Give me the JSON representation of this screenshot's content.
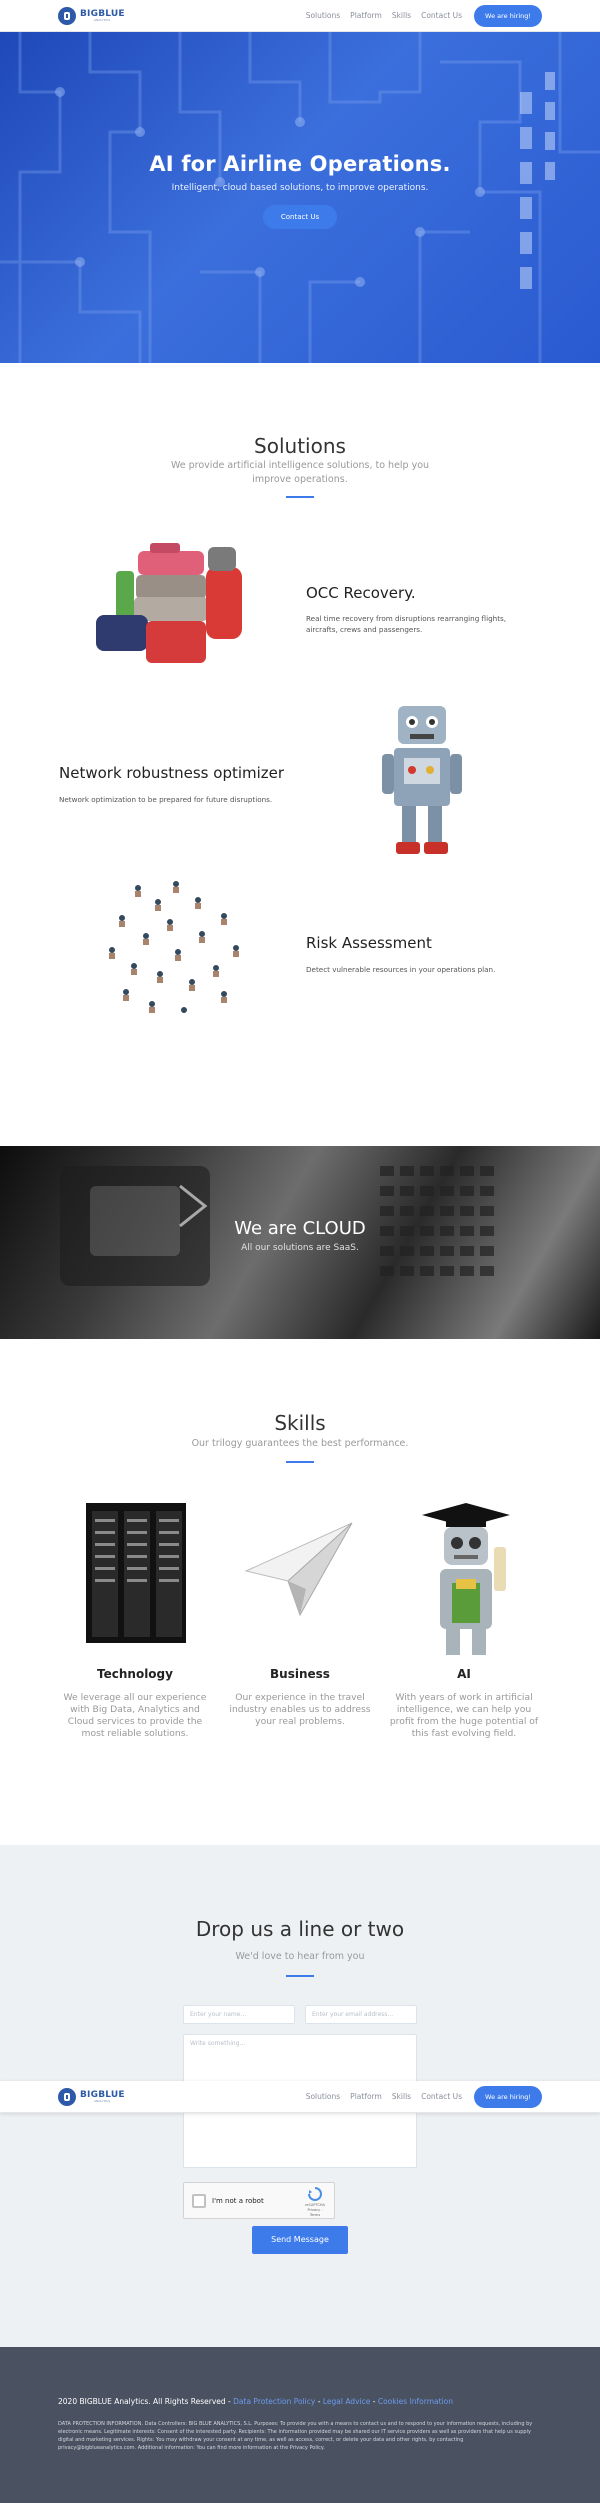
{
  "brand": {
    "name": "BIGBLUE",
    "tagline": "ANALYTICS"
  },
  "nav": {
    "links": [
      "Solutions",
      "Platform",
      "Skills",
      "Contact Us"
    ],
    "cta": "We are hiring!"
  },
  "hero": {
    "title": "AI for Airline Operations.",
    "subtitle": "Intelligent, cloud based solutions, to improve operations.",
    "button": "Contact Us"
  },
  "solutions": {
    "title": "Solutions",
    "subtitle": "We provide artificial intelligence solutions, to help you improve operations.",
    "items": [
      {
        "title": "OCC Recovery.",
        "text": "Real time recovery from disruptions rearranging flights, aircrafts, crews and passengers.",
        "image": "luggage-icon"
      },
      {
        "title": "Network robustness optimizer",
        "text": "Network optimization to be prepared for future disruptions.",
        "image": "robot-icon"
      },
      {
        "title": "Risk Assessment",
        "text": "Detect vulnerable resources in your operations plan.",
        "image": "crowd-icon"
      }
    ]
  },
  "cloud": {
    "title": "We are CLOUD",
    "subtitle": "All our solutions are SaaS."
  },
  "skills": {
    "title": "Skills",
    "subtitle": "Our trilogy guarantees the best performance.",
    "items": [
      {
        "title": "Technology",
        "text": "We leverage all our experience with Big Data, Analytics and Cloud services to provide the most reliable solutions.",
        "image": "server-rack-icon"
      },
      {
        "title": "Business",
        "text": "Our experience in the travel industry enables us to address your real problems.",
        "image": "paper-plane-icon"
      },
      {
        "title": "AI",
        "text": "With years of work in artificial intelligence, we can help you profit from the huge potential of this fast evolving field.",
        "image": "graduate-robot-icon"
      }
    ]
  },
  "contact": {
    "title": "Drop us a line or two",
    "subtitle": "We'd love to hear from you",
    "name_placeholder": "Enter your name...",
    "email_placeholder": "Enter your email address...",
    "message_placeholder": "Write something...",
    "captcha_label": "I'm not a robot",
    "captcha_brand": "reCAPTCHA",
    "captcha_terms": "Privacy - Terms",
    "send": "Send Message"
  },
  "footer": {
    "copyright": "2020 BIGBLUE Analytics. All Rights Reserved - ",
    "links": [
      "Data Protection Policy",
      "Legal Advice",
      "Cookies Information"
    ],
    "legal": "DATA PROTECTION INFORMATION. Data Controllers: BIG BLUE ANALYTICS, S.L. Purposes: To provide you with a means to contact us and to respond to your information requests, including by electronic means. Legitimate interests: Consent of the interested party. Recipients: The information provided may be shared our IT service providers as well as providers that help us supply digital and marketing services. Rights: You may withdraw your consent at any time, as well as access, correct, or delete your data and other rights, by contacting privacy@bigblueanalytics.com. Additional information: You can find more information at the Privacy Policy."
  },
  "colors": {
    "accent": "#3e7bea",
    "brand": "#2d5aa8",
    "footer": "#4a5160",
    "contact_bg": "#eef1f4"
  }
}
